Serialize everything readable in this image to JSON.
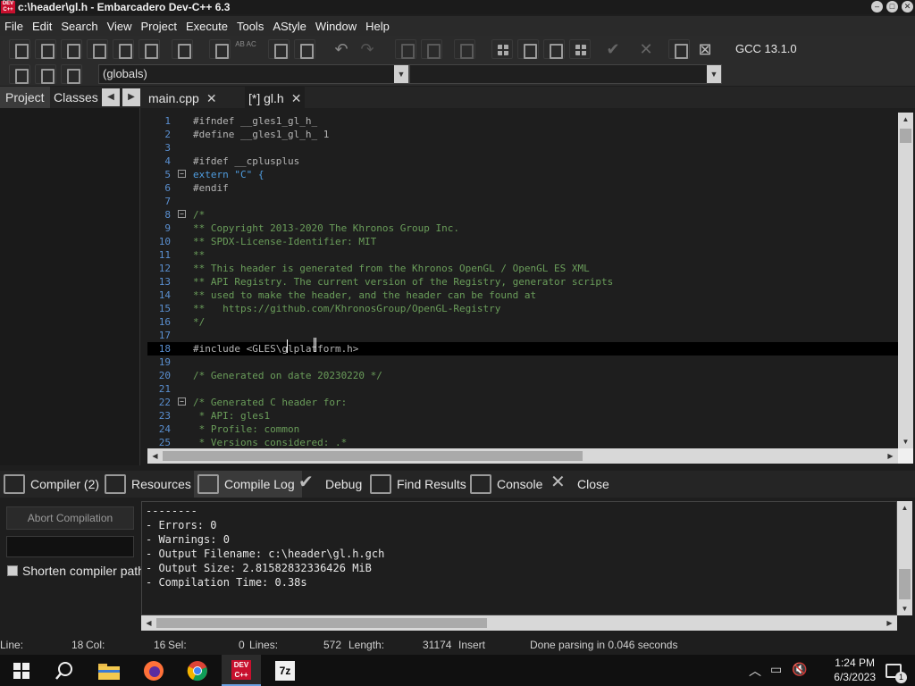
{
  "window": {
    "title": "c:\\header\\gl.h - Embarcadero Dev-C++ 6.3",
    "icon_label": "DEV C++"
  },
  "menu": [
    "File",
    "Edit",
    "Search",
    "View",
    "Project",
    "Execute",
    "Tools",
    "AStyle",
    "Window",
    "Help"
  ],
  "toolbar": {
    "compiler": "GCC 13.1.0",
    "globals": "(globals)",
    "ab_ac_label": "AB AC"
  },
  "left_panel": {
    "tabs": [
      "Project",
      "Classes"
    ],
    "prev_arrow": "◀",
    "next_arrow": "▶"
  },
  "editor_tabs": [
    {
      "label": "main.cpp",
      "close": "✕"
    },
    {
      "label": "[*] gl.h",
      "close": "✕"
    }
  ],
  "code_lines": [
    {
      "n": "1",
      "text": "#ifndef __gles1_gl_h_",
      "fold": ""
    },
    {
      "n": "2",
      "text": "#define __gles1_gl_h_ 1",
      "fold": ""
    },
    {
      "n": "3",
      "text": "",
      "fold": ""
    },
    {
      "n": "4",
      "text": "#ifdef __cplusplus",
      "fold": ""
    },
    {
      "n": "5",
      "text": "extern \"C\" {",
      "fold": "−"
    },
    {
      "n": "6",
      "text": "#endif",
      "fold": ""
    },
    {
      "n": "7",
      "text": "",
      "fold": ""
    },
    {
      "n": "8",
      "text": "/*",
      "fold": "−"
    },
    {
      "n": "9",
      "text": "** Copyright 2013-2020 The Khronos Group Inc.",
      "fold": ""
    },
    {
      "n": "10",
      "text": "** SPDX-License-Identifier: MIT",
      "fold": ""
    },
    {
      "n": "11",
      "text": "**",
      "fold": ""
    },
    {
      "n": "12",
      "text": "** This header is generated from the Khronos OpenGL / OpenGL ES XML",
      "fold": ""
    },
    {
      "n": "13",
      "text": "** API Registry. The current version of the Registry, generator scripts",
      "fold": ""
    },
    {
      "n": "14",
      "text": "** used to make the header, and the header can be found at",
      "fold": ""
    },
    {
      "n": "15",
      "text": "**   https://github.com/KhronosGroup/OpenGL-Registry",
      "fold": ""
    },
    {
      "n": "16",
      "text": "*/",
      "fold": ""
    },
    {
      "n": "17",
      "text": "",
      "fold": ""
    },
    {
      "n": "18",
      "text": "#include <GLES\\glplatform.h>",
      "fold": ""
    },
    {
      "n": "19",
      "text": "",
      "fold": ""
    },
    {
      "n": "20",
      "text": "/* Generated on date 20230220 */",
      "fold": ""
    },
    {
      "n": "21",
      "text": "",
      "fold": ""
    },
    {
      "n": "22",
      "text": "/* Generated C header for:",
      "fold": "−"
    },
    {
      "n": "23",
      "text": " * API: gles1",
      "fold": ""
    },
    {
      "n": "24",
      "text": " * Profile: common",
      "fold": ""
    },
    {
      "n": "25",
      "text": " * Versions considered: .*",
      "fold": ""
    }
  ],
  "bottom_tabs": [
    "Compiler (2)",
    "Resources",
    "Compile Log",
    "Debug",
    "Find Results",
    "Console",
    "Close"
  ],
  "compile_panel": {
    "abort_label": "Abort Compilation",
    "shorten_label": "Shorten compiler path",
    "log_lines": [
      "--------",
      "- Errors: 0",
      "- Warnings: 0",
      "- Output Filename: c:\\header\\gl.h.gch",
      "- Output Size: 2.81582832336426 MiB",
      "- Compilation Time: 0.38s"
    ]
  },
  "status": {
    "line_label": "Line:",
    "line_value": "18",
    "col_label": "Col:",
    "col_value": "16",
    "sel_label": "Sel:",
    "sel_value": "0",
    "lines_label": "Lines:",
    "lines_value": "572",
    "length_label": "Length:",
    "length_value": "31174",
    "mode": "Insert",
    "message": "Done parsing in 0.046 seconds"
  },
  "taskbar": {
    "time": "1:24 PM",
    "date": "6/3/2023",
    "notification_count": "1",
    "devcpp_label": "DEV C++",
    "sevenzip_label": "7z"
  },
  "colors": {
    "accent": "#4f9de0",
    "comment": "#6a9d5a",
    "line_number": "#5a8fd0",
    "app_icon": "#c8102e"
  }
}
